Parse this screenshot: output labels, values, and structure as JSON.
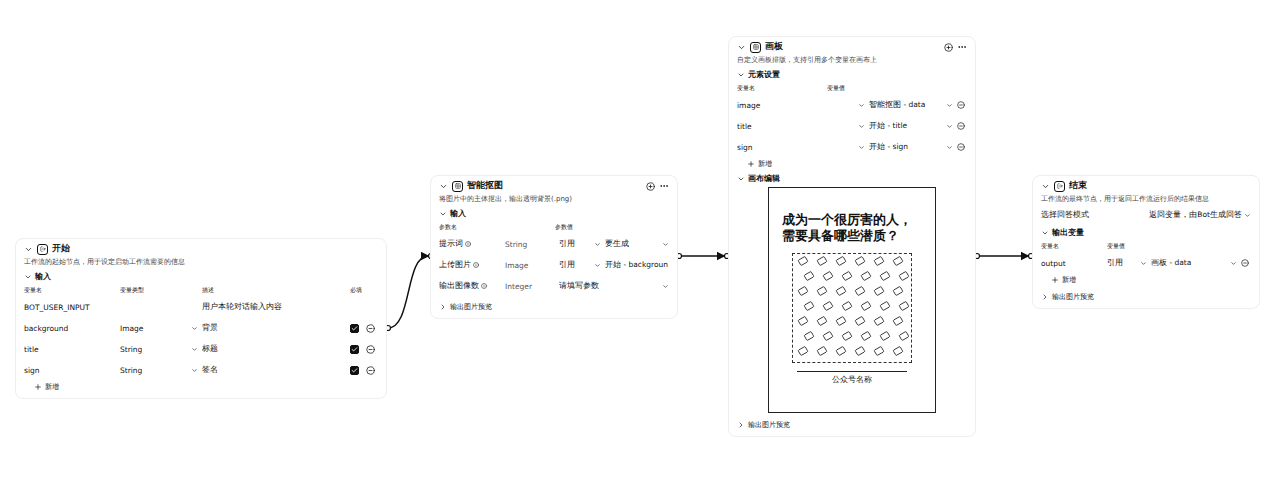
{
  "start": {
    "title": "开始",
    "description": "工作流的起始节点，用于设定启动工作流需要的信息",
    "section": "输入",
    "columns": [
      "变量名",
      "变量类型",
      "描述",
      "必填"
    ],
    "rows": [
      {
        "name": "BOT_USER_INPUT",
        "type": "",
        "desc": "用户本轮对话输入内容",
        "kind": "system",
        "required": false
      },
      {
        "name": "background",
        "type": "Image",
        "desc": "背景",
        "kind": "param",
        "required": true
      },
      {
        "name": "title",
        "type": "String",
        "desc": "标题",
        "kind": "param",
        "required": true
      },
      {
        "name": "sign",
        "type": "String",
        "desc": "签名",
        "kind": "param",
        "required": true
      }
    ],
    "add": "新增"
  },
  "cutout": {
    "title": "智能抠图",
    "description": "将图片中的主体抠出，输出透明背景(.png)",
    "section": "输入",
    "columns": [
      "参数名",
      "参数值"
    ],
    "inputs": [
      {
        "name": "提示词",
        "type": "String",
        "kind": "ref",
        "mode": "引用",
        "value": "要生成"
      },
      {
        "name": "上传图片",
        "type": "Image",
        "kind": "ref",
        "mode": "引用",
        "value": "开始 - backgroun"
      },
      {
        "name": "输出图像数",
        "type": "Integer",
        "kind": "input",
        "mode": "",
        "value": "请填写参数"
      }
    ],
    "preview": "输出图片预览"
  },
  "board": {
    "title": "画板",
    "description": "自定义画板排版，支持引用多个变量在画布上",
    "section": "元素设置",
    "columns": [
      "变量名",
      "变量值"
    ],
    "elements": [
      {
        "name": "image",
        "value": "智能抠图 - data"
      },
      {
        "name": "title",
        "value": "开始 - title"
      },
      {
        "name": "sign",
        "value": "开始 - sign"
      }
    ],
    "add": "新增",
    "canvasSection": "画布编辑",
    "canvas": {
      "headline": "成为一个很厉害的人，需要具备哪些潜质？",
      "footer": "公众号名称"
    },
    "preview": "输出图片预览"
  },
  "end": {
    "title": "结束",
    "description": "工作流的最终节点，用于返回工作流运行后的结果信息",
    "modeLabel": "选择回答模式",
    "modeValue": "返回变量，由Bot生成回答",
    "section": "输出变量",
    "columns": [
      "变量名",
      "变量值"
    ],
    "outputs": [
      {
        "name": "output",
        "mode": "引用",
        "value": "画板 - data"
      }
    ],
    "add": "新增",
    "preview": "输出图片预览"
  }
}
